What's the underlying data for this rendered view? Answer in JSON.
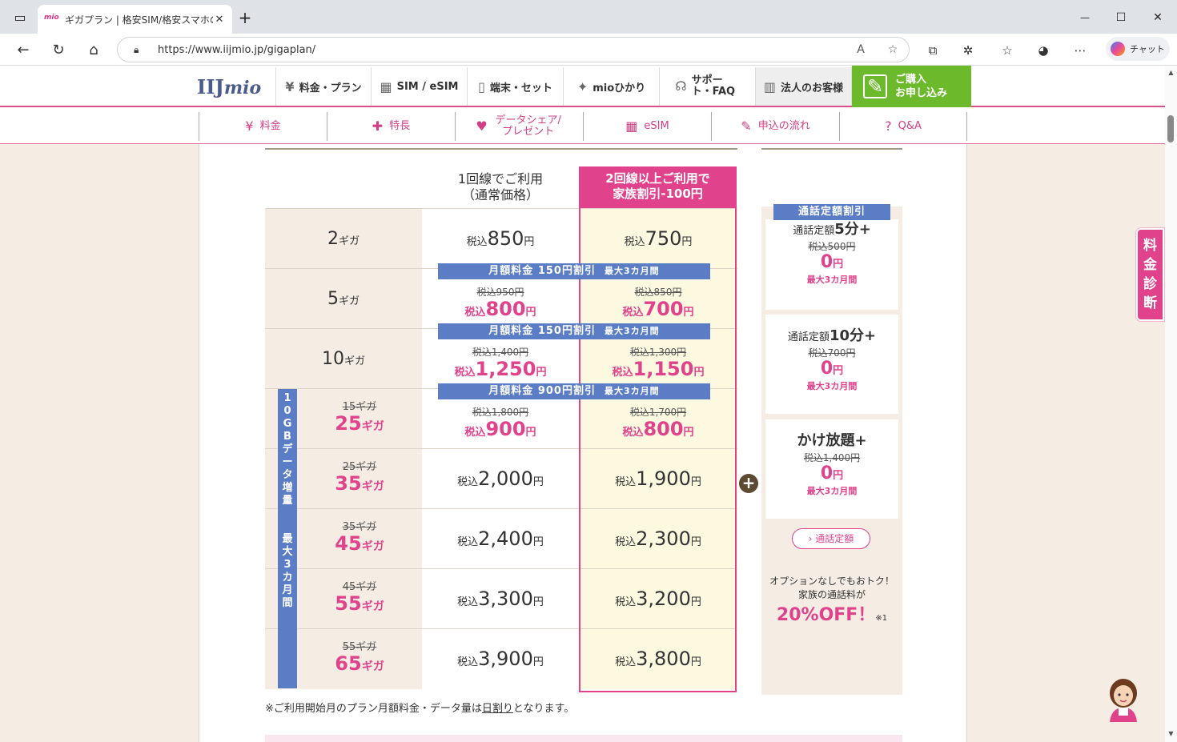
{
  "browser": {
    "tab_title": "ギガプラン | 格安SIM/格安スマホのIIJ",
    "favicon_text": "mio",
    "tab_close": "✕",
    "new_tab": "+",
    "url": "https://www.iijmio.jp/gigaplan/",
    "chat_label": "チャット",
    "win_min": "—",
    "win_max": "☐",
    "win_close": "✕"
  },
  "header": {
    "logo_main": "IIJ",
    "logo_sub": "mio",
    "nav": [
      {
        "icon": "¥",
        "label": "料金・プラン"
      },
      {
        "icon": "▦",
        "label": "SIM / eSIM"
      },
      {
        "icon": "▯",
        "label": "端末・セット"
      },
      {
        "icon": "✦",
        "label": "mioひかり"
      },
      {
        "icon": "☊",
        "label": "サポート・FAQ"
      },
      {
        "icon": "▥",
        "label": "法人のお客様"
      }
    ],
    "cta_line1": "ご購入",
    "cta_line2": "お申し込み"
  },
  "subnav": [
    {
      "icon": "¥",
      "label": "料金"
    },
    {
      "icon": "✚",
      "label": "特長"
    },
    {
      "icon": "♥",
      "label": "データシェア/プレゼント"
    },
    {
      "icon": "▦",
      "label": "eSIM"
    },
    {
      "icon": "✎",
      "label": "申込の流れ"
    },
    {
      "icon": "?",
      "label": "Q&A"
    }
  ],
  "table": {
    "col1_line1": "1回線でご利用",
    "col1_line2": "（通常価格）",
    "col2_line1": "2回線以上ご利用で",
    "col2_line2": "家族割引-100円",
    "tax": "税込",
    "yen": "円",
    "giga": "ギガ",
    "rows": [
      {
        "gig": "2",
        "p1": "850",
        "p2": "750"
      },
      {
        "gig": "5",
        "p1_old": "税込950円",
        "p1": "800",
        "p2_old": "税込850円",
        "p2": "700"
      },
      {
        "gig": "10",
        "p1_old": "税込1,400円",
        "p1": "1,250",
        "p2_old": "税込1,300円",
        "p2": "1,150"
      },
      {
        "gig_old": "15ギガ",
        "gig": "25",
        "p1_old": "税込1,800円",
        "p1": "900",
        "p2_old": "税込1,700円",
        "p2": "800"
      },
      {
        "gig_old": "25ギガ",
        "gig": "35",
        "p1": "2,000",
        "p2": "1,900"
      },
      {
        "gig_old": "35ギガ",
        "gig": "45",
        "p1": "2,400",
        "p2": "2,300"
      },
      {
        "gig_old": "45ギガ",
        "gig": "55",
        "p1": "3,300",
        "p2": "3,200"
      },
      {
        "gig_old": "55ギガ",
        "gig": "65",
        "p1": "3,900",
        "p2": "3,800"
      }
    ],
    "band_5": "月額料金 150円割引",
    "band_10": "月額料金 150円割引",
    "band_25": "月額料金 900円割引",
    "band_suffix": "最大3カ月間",
    "vbar": "10GBデータ増量 最大3カ月間",
    "note_pre": "※ご利用開始月のプラン月額料金・データ量は",
    "note_link": "日割り",
    "note_post": "となります。"
  },
  "side": {
    "header": "通話定額割引",
    "options": [
      {
        "prefix": "通話定額",
        "name": "5分+",
        "old": "税込500円",
        "zero": "0",
        "yen": "円",
        "period": "最大3カ月間"
      },
      {
        "prefix": "通話定額",
        "name": "10分+",
        "old": "税込700円",
        "zero": "0",
        "yen": "円",
        "period": "最大3カ月間"
      },
      {
        "prefix": "",
        "name": "かけ放題+",
        "old": "税込1,400円",
        "zero": "0",
        "yen": "円",
        "period": "最大3カ月間"
      }
    ],
    "button": "通話定額",
    "promo_line1": "オプションなしでもおトク！",
    "promo_line2": "家族の通話料が",
    "promo_big": "20%OFF！",
    "promo_note": "※1"
  },
  "float": {
    "diagnosis": "料金診断"
  }
}
